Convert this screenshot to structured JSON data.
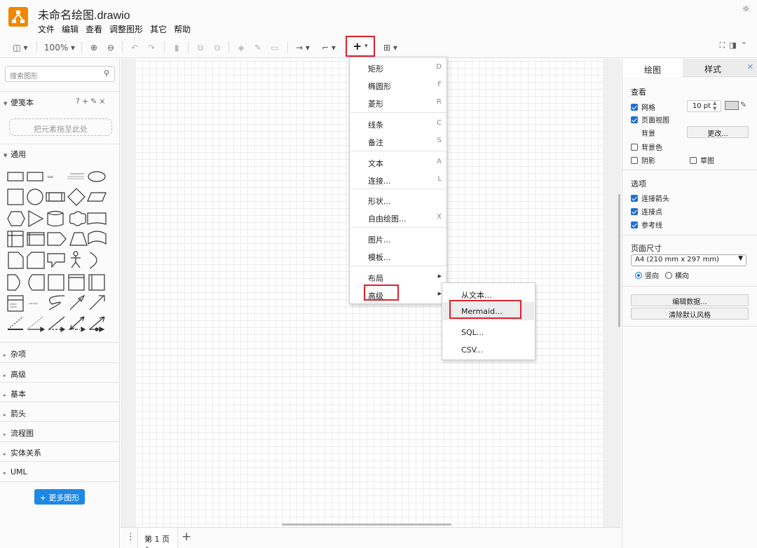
{
  "app": {
    "title": "未命名绘图.drawio"
  },
  "menubar": [
    "文件",
    "编辑",
    "查看",
    "调整图形",
    "其它",
    "帮助"
  ],
  "toolbar": {
    "zoom": "100%",
    "add_label": "+"
  },
  "sidebar": {
    "search_placeholder": "搜索图形",
    "scratchpad": {
      "title": "便笺本",
      "drop_hint": "把元素拖至此处"
    },
    "general": {
      "title": "通用"
    },
    "sections": [
      "杂项",
      "高级",
      "基本",
      "箭头",
      "流程图",
      "实体关系",
      "UML"
    ],
    "more_shapes": "+ 更多图形"
  },
  "bottom": {
    "page_tab": "第 1 页"
  },
  "format": {
    "tabs": [
      "绘图",
      "样式"
    ],
    "view": {
      "title": "查看",
      "grid": "网格",
      "grid_size": "10 pt",
      "page_view": "页面视图",
      "background": "背景",
      "change": "更改...",
      "bg_color": "背景色",
      "shadow": "阴影",
      "sketch": "草图"
    },
    "options": {
      "title": "选项",
      "connection_arrows": "连接箭头",
      "connection_points": "连接点",
      "guides": "参考线"
    },
    "paper": {
      "title": "页面尺寸",
      "size": "A4 (210 mm x 297 mm)",
      "portrait": "竖向",
      "landscape": "横向"
    },
    "edit_data": "编辑数据...",
    "clear_style": "清除默认风格"
  },
  "insert_menu": {
    "items": [
      {
        "label": "矩形",
        "shortcut": "D"
      },
      {
        "label": "椭圆形",
        "shortcut": "F"
      },
      {
        "label": "菱形",
        "shortcut": "R"
      },
      {
        "label": "线条",
        "shortcut": "C"
      },
      {
        "label": "备注",
        "shortcut": "S"
      },
      {
        "label": "文本",
        "shortcut": "A"
      },
      {
        "label": "连接...",
        "shortcut": "L"
      },
      {
        "label": "形状...",
        "shortcut": ""
      },
      {
        "label": "自由绘图...",
        "shortcut": "X"
      },
      {
        "label": "图片...",
        "shortcut": ""
      },
      {
        "label": "模板...",
        "shortcut": ""
      },
      {
        "label": "布局",
        "shortcut": ""
      },
      {
        "label": "高级",
        "shortcut": ""
      }
    ]
  },
  "advanced_menu": {
    "items": [
      "从文本...",
      "Mermaid...",
      "SQL...",
      "CSV..."
    ]
  }
}
